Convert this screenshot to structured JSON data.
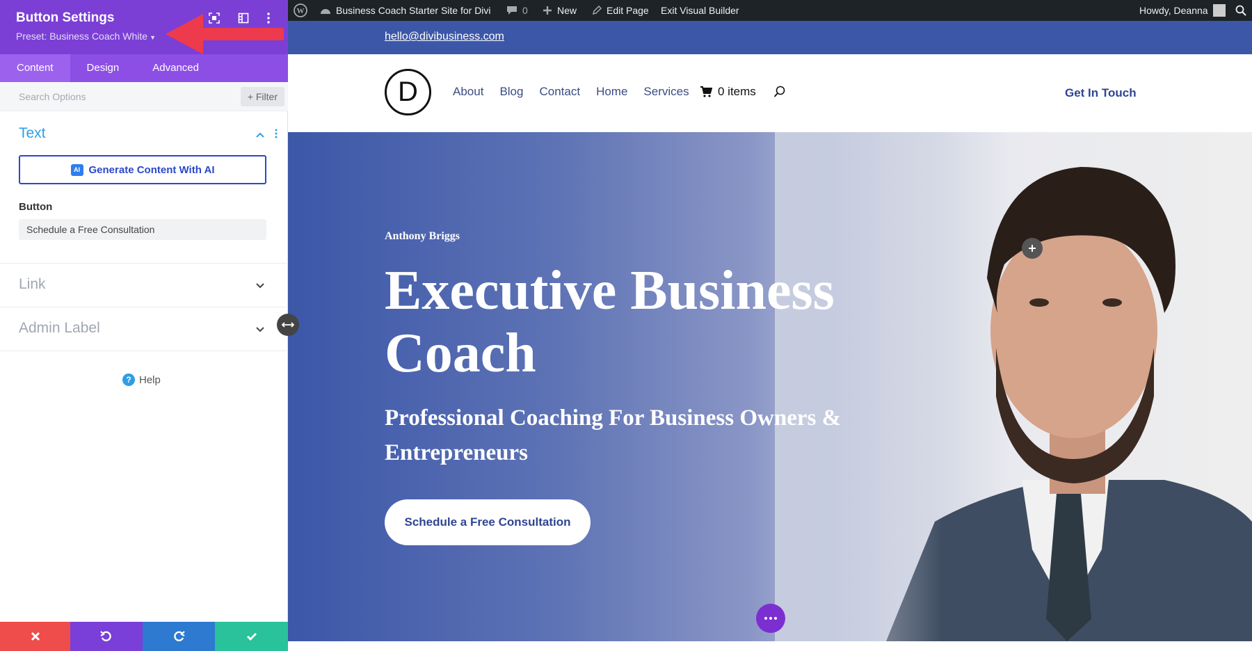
{
  "panel": {
    "title": "Button Settings",
    "preset": "Preset: Business Coach White",
    "tabs": [
      {
        "label": "Content"
      },
      {
        "label": "Design"
      },
      {
        "label": "Advanced"
      }
    ],
    "search_placeholder": "Search Options",
    "filter_label": "+ Filter",
    "text_section": "Text",
    "ai_button": "Generate Content With AI",
    "ai_badge": "AI",
    "button_label": "Button",
    "button_value": "Schedule a Free Consultation",
    "link_section": "Link",
    "admin_label_section": "Admin Label",
    "help": "Help",
    "help_icon": "?"
  },
  "adminbar": {
    "site_name": "Business Coach Starter Site for Divi",
    "comments": "0",
    "new": "New",
    "edit_page": "Edit Page",
    "exit_builder": "Exit Visual Builder",
    "howdy": "Howdy, Deanna"
  },
  "site": {
    "email": "hello@divibusiness.com",
    "logo_letter": "D",
    "nav": [
      {
        "label": "About"
      },
      {
        "label": "Blog"
      },
      {
        "label": "Contact"
      },
      {
        "label": "Home"
      },
      {
        "label": "Services"
      }
    ],
    "cart": "0 items",
    "cta": "Get In Touch",
    "hero": {
      "eyebrow": "Anthony Briggs",
      "title": "Executive Business Coach",
      "subtitle": "Professional Coaching For Business Owners & Entrepreneurs",
      "button": "Schedule a Free Consultation"
    }
  },
  "colors": {
    "panel_purple": "#7b3fd6",
    "accent_blue": "#2e9ee6",
    "site_blue": "#3c57a8",
    "cancel_red": "#ef4c4c",
    "undo_purple": "#7a3fd8",
    "redo_blue": "#2d7ad0",
    "save_green": "#29c29a"
  }
}
